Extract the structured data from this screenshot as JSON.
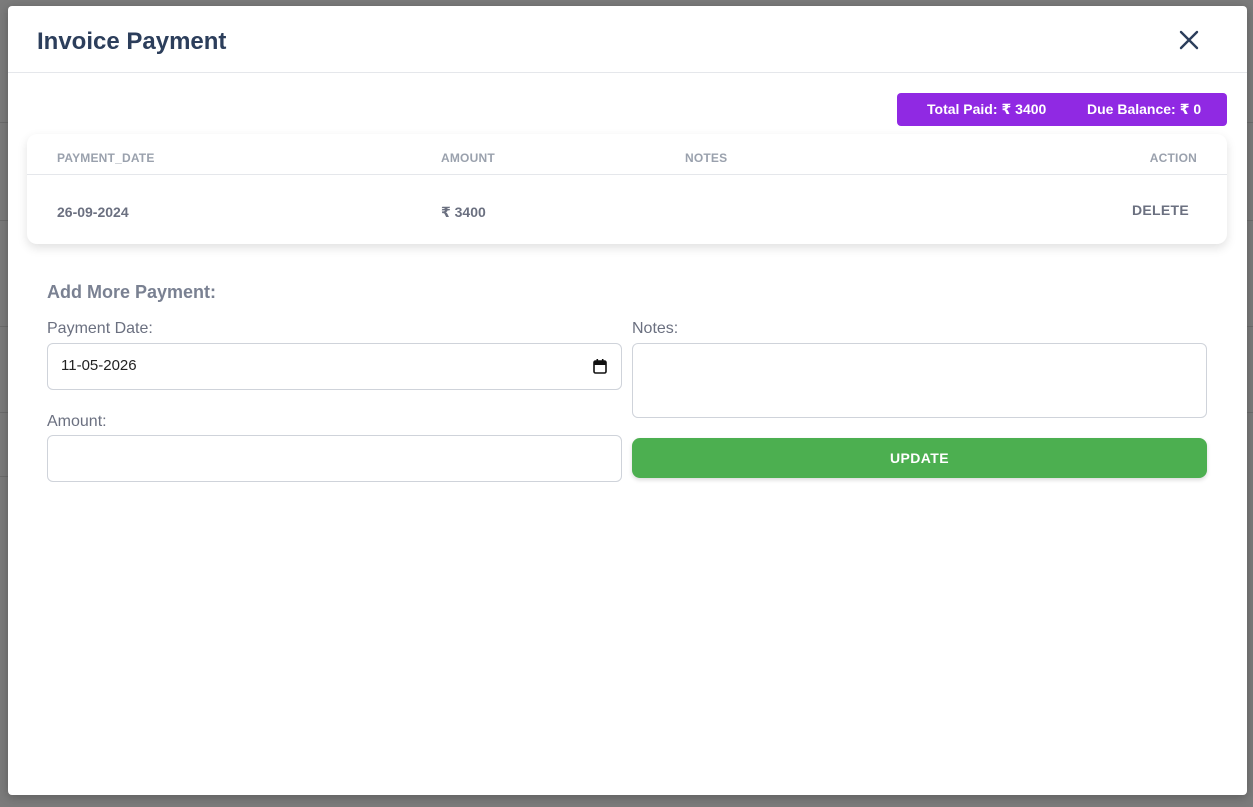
{
  "modal": {
    "title": "Invoice Payment",
    "close_icon": "close-icon"
  },
  "summary": {
    "total_paid_label": "Total Paid:",
    "total_paid_value": "₹ 3400",
    "due_balance_label": "Due Balance:",
    "due_balance_value": "₹ 0",
    "badge_color": "#9029e3"
  },
  "payments_table": {
    "columns": [
      "PAYMENT_DATE",
      "AMOUNT",
      "NOTES",
      "ACTION"
    ],
    "rows": [
      {
        "payment_date": "26-09-2024",
        "amount": "₹ 3400",
        "notes": "",
        "action": "DELETE"
      }
    ]
  },
  "form": {
    "section_title": "Add More Payment:",
    "payment_date_label": "Payment Date:",
    "payment_date_value": "11-05-2026",
    "amount_label": "Amount:",
    "amount_value": "",
    "notes_label": "Notes:",
    "notes_value": "",
    "submit_label": "UPDATE",
    "submit_color": "#4caf50"
  }
}
